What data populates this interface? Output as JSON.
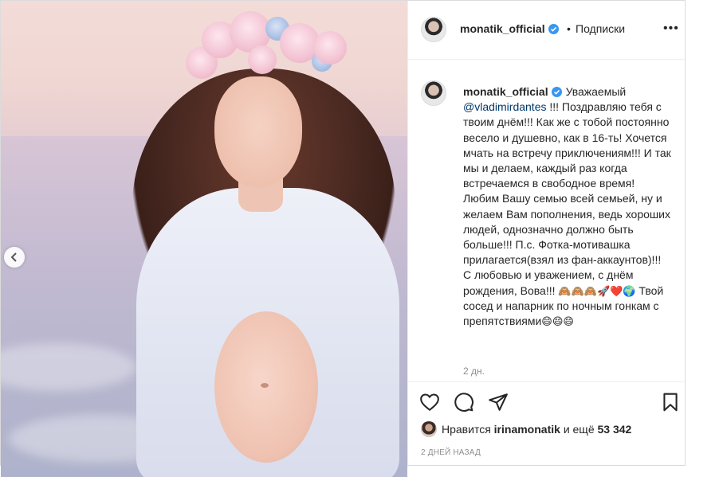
{
  "photo": {
    "alt": "",
    "prev_icon": "chevron-left-icon"
  },
  "header": {
    "username": "monatik_official",
    "separator": "•",
    "follow_label": "Подписки",
    "more_label": "•••"
  },
  "caption": {
    "username": "monatik_official",
    "text_start": "Уважаемый",
    "mention": "@vladimirdantes",
    "text_body": " !!! Поздравляю тебя с твоим днём!!! Как же с тобой постоянно весело и душевно, как в 16-ть! Хочется мчать на встречу приключениям!!! И так мы и делаем, каждый раз когда встречаемся в свободное время! Любим Вашу семью всей семьей, ну и желаем Вам пополнения, ведь хороших людей, однозначно должно быть больше!!! П.с. Фотка-мотивашка прилагается(взял из фан-аккаунтов)!!! С любовью и уважением, с днём рождения, Вова!!! ",
    "emoji_group": "🙈🙈🙈🚀❤️🌍",
    "text_end": " Твой сосед и напарник по ночным гонкам с препятствиями",
    "emoji_end": "😄😄😄",
    "time_ago": "2 дн."
  },
  "actions": {
    "like_icon": "heart-icon",
    "comment_icon": "comment-icon",
    "share_icon": "paper-plane-icon",
    "save_icon": "bookmark-icon"
  },
  "likes": {
    "prefix": "Нравится",
    "user": "irinamonatik",
    "middle": "и ещё",
    "count": "53 342"
  },
  "date": "2 ДНЕЙ НАЗАД",
  "colors": {
    "verified": "#3897f0",
    "mention": "#00376b",
    "text": "#262626",
    "muted": "#8e8e8e",
    "border": "#efefef"
  }
}
